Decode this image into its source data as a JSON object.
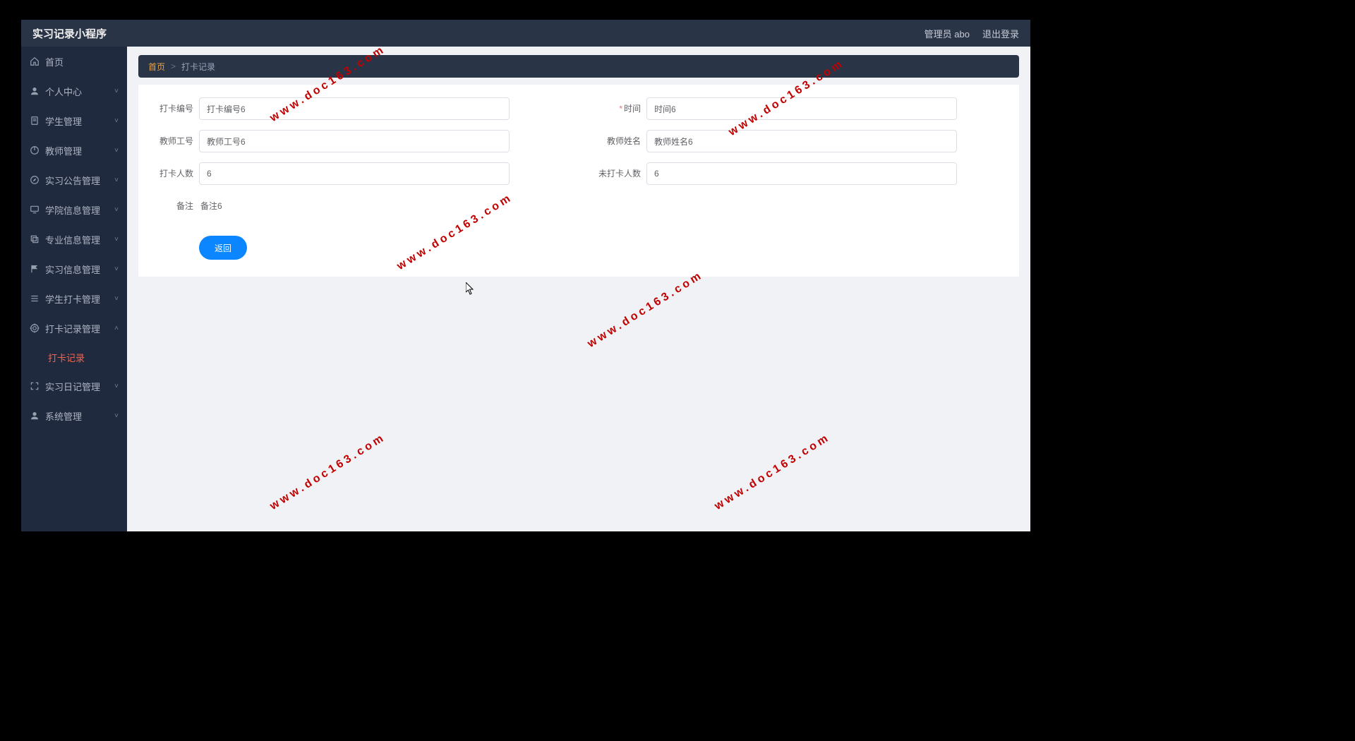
{
  "header": {
    "title": "实习记录小程序",
    "admin_label": "管理员 abo",
    "logout_label": "退出登录"
  },
  "sidebar": {
    "items": [
      {
        "icon": "home",
        "label": "首页",
        "has_children": false
      },
      {
        "icon": "user",
        "label": "个人中心",
        "has_children": true
      },
      {
        "icon": "doc",
        "label": "学生管理",
        "has_children": true
      },
      {
        "icon": "power",
        "label": "教师管理",
        "has_children": true
      },
      {
        "icon": "compass",
        "label": "实习公告管理",
        "has_children": true
      },
      {
        "icon": "monitor",
        "label": "学院信息管理",
        "has_children": true
      },
      {
        "icon": "copy",
        "label": "专业信息管理",
        "has_children": true
      },
      {
        "icon": "flag",
        "label": "实习信息管理",
        "has_children": true
      },
      {
        "icon": "list",
        "label": "学生打卡管理",
        "has_children": true
      },
      {
        "icon": "target",
        "label": "打卡记录管理",
        "has_children": true,
        "expanded": true
      },
      {
        "icon": "fullscreen",
        "label": "实习日记管理",
        "has_children": true
      },
      {
        "icon": "person",
        "label": "系统管理",
        "has_children": true
      }
    ],
    "active_sub_label": "打卡记录"
  },
  "breadcrumb": {
    "home": "首页",
    "sep": ">",
    "current": "打卡记录"
  },
  "form": {
    "fields": {
      "record_no": {
        "label": "打卡编号",
        "value": "打卡编号6"
      },
      "time": {
        "label": "时间",
        "value": "时间6",
        "required": true
      },
      "teacher_id": {
        "label": "教师工号",
        "value": "教师工号6"
      },
      "teacher_name": {
        "label": "教师姓名",
        "value": "教师姓名6"
      },
      "checked": {
        "label": "打卡人数",
        "value": "6"
      },
      "unchecked": {
        "label": "未打卡人数",
        "value": "6"
      },
      "remark": {
        "label": "备注",
        "value": "备注6"
      }
    },
    "return_label": "返回"
  },
  "watermark": "www.doc163.com"
}
